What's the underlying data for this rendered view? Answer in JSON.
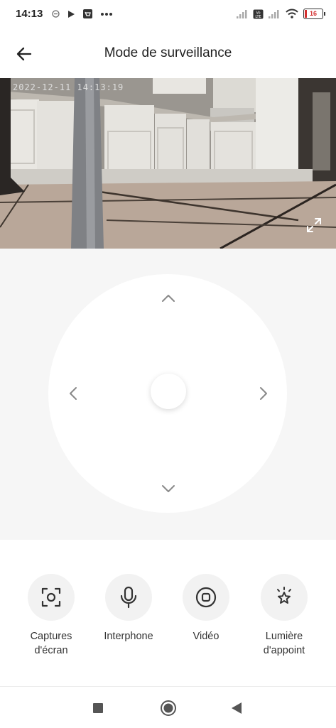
{
  "status": {
    "time": "14:13",
    "battery": "16",
    "icons": [
      "notification-icon",
      "play-store-icon",
      "shopping-bag-icon",
      "more-dots-icon",
      "signal-icon",
      "volte-icon",
      "wifi-icon",
      "battery-icon"
    ]
  },
  "header": {
    "title": "Mode de surveillance",
    "back_icon": "arrow-left-icon"
  },
  "camera": {
    "timestamp": "2022-12-11 14:13:19",
    "fullscreen_icon": "expand-icon"
  },
  "joystick": {
    "up_icon": "chevron-up-icon",
    "down_icon": "chevron-down-icon",
    "left_icon": "chevron-left-icon",
    "right_icon": "chevron-right-icon"
  },
  "actions": [
    {
      "label_line1": "Captures",
      "label_line2": "d'écran",
      "icon": "screenshot-icon"
    },
    {
      "label_line1": "Interphone",
      "label_line2": "",
      "icon": "microphone-icon"
    },
    {
      "label_line1": "Vidéo",
      "label_line2": "",
      "icon": "record-icon"
    },
    {
      "label_line1": "Lumière",
      "label_line2": "d'appoint",
      "icon": "light-icon"
    }
  ],
  "colors": {
    "background": "#ffffff",
    "control_background": "#f6f6f6",
    "icon": "#333333",
    "battery_low": "#d32f2f"
  }
}
